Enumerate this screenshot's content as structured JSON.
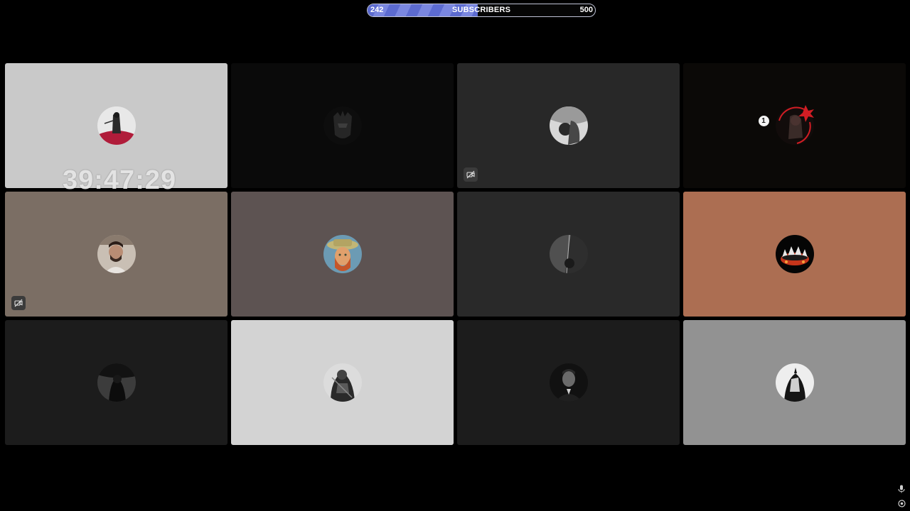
{
  "subscriber_goal": {
    "current": "242",
    "label": "SUBSCRIBERS",
    "goal": "500",
    "progress_fraction": 0.484,
    "fill_color": "#6a78d8"
  },
  "timer": {
    "value": "39:47:29"
  },
  "tiles": [
    {
      "bg": "#c9c9c9",
      "avatar": "samurai-red-cloak",
      "muted": false
    },
    {
      "bg": "#0a0a0a",
      "avatar": "dark-knight",
      "muted": false
    },
    {
      "bg": "#282828",
      "avatar": "bw-portrait",
      "muted": true
    },
    {
      "bg": "#0b0907",
      "avatar": "red-ring-portrait",
      "muted": false,
      "badge": "1"
    },
    {
      "bg": "#7b6e64",
      "avatar": "bearded-man-photo",
      "muted": true
    },
    {
      "bg": "#5d5352",
      "avatar": "van-gogh-portrait",
      "muted": false
    },
    {
      "bg": "#292929",
      "avatar": "dark-figure",
      "muted": false
    },
    {
      "bg": "#ac6e52",
      "avatar": "fire-crown",
      "muted": false
    },
    {
      "bg": "#1c1c1c",
      "avatar": "cloaked-figure",
      "muted": false
    },
    {
      "bg": "#d3d3d3",
      "avatar": "armored-knight",
      "muted": false
    },
    {
      "bg": "#1c1c1c",
      "avatar": "man-portrait",
      "muted": false
    },
    {
      "bg": "#929292",
      "avatar": "hooded-figure",
      "muted": false
    }
  ],
  "icons": {
    "muted": "video-off-icon",
    "mic": "mic-icon",
    "settings": "settings-icon"
  }
}
